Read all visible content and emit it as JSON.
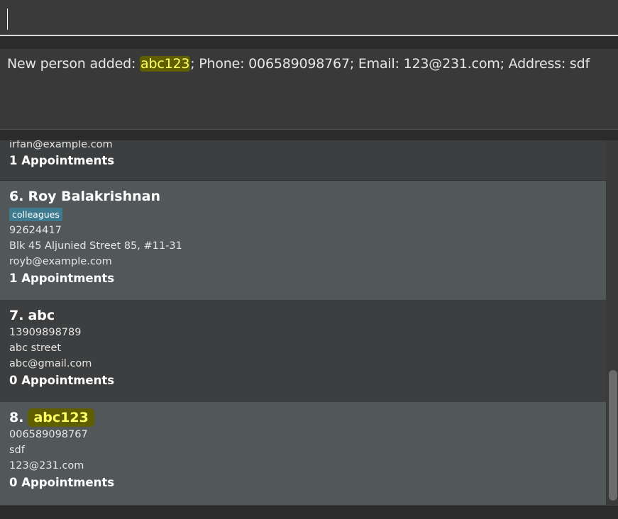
{
  "command_box": {
    "value": "",
    "placeholder": ""
  },
  "result_display": {
    "prefix": "New person added: ",
    "highlight": "abc123",
    "suffix": "; Phone: 006589098767; Email: 123@231.com; Address: sdf"
  },
  "persons": [
    {
      "index": "",
      "name": "",
      "email": "irfan@example.com",
      "appointments": "1 Appointments"
    },
    {
      "index": "6.",
      "name": "Roy Balakrishnan",
      "tag": "colleagues",
      "phone": "92624417",
      "address": "Blk 45 Aljunied Street 85, #11-31",
      "email": "royb@example.com",
      "appointments": "1 Appointments"
    },
    {
      "index": "7.",
      "name": "abc",
      "phone": "13909898789",
      "address": "abc street",
      "email": "abc@gmail.com",
      "appointments": "0 Appointments"
    },
    {
      "index": "8.",
      "name": "abc123",
      "phone": "006589098767",
      "address": "sdf",
      "email": "123@231.com",
      "appointments": "0 Appointments"
    }
  ],
  "colors": {
    "background": "#333334",
    "card_dark": "#3c3e3f",
    "card_light": "#525759",
    "tag": "#3e7b91",
    "highlight_bg": "#5f5f00",
    "highlight_fg": "#ffff66"
  }
}
